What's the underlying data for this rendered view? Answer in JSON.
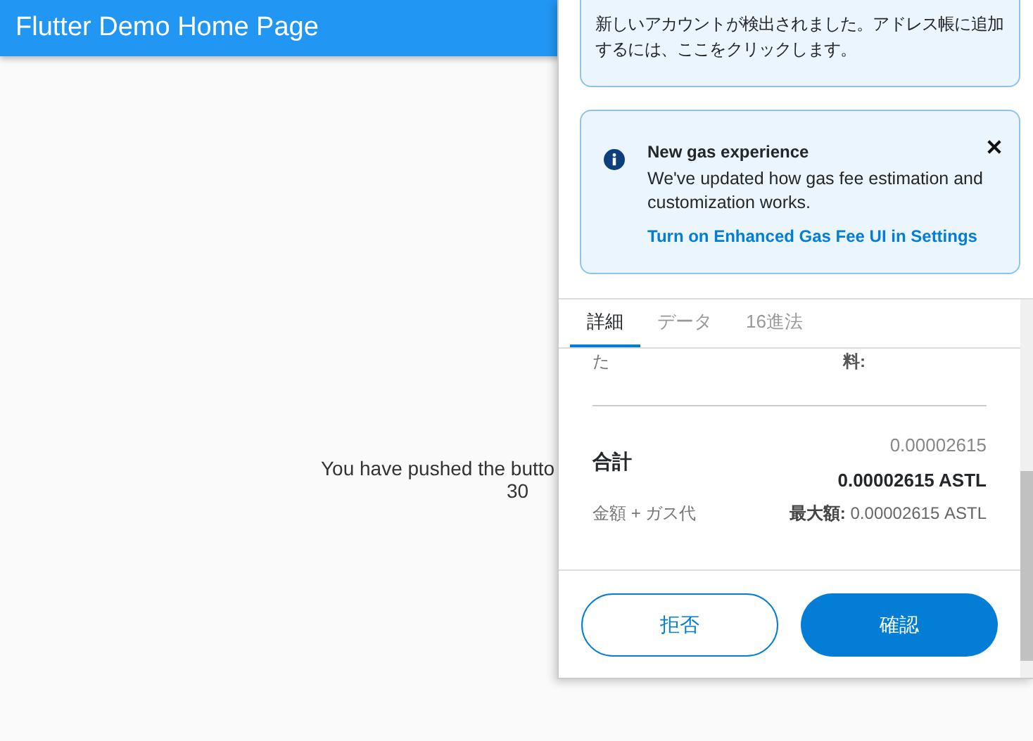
{
  "app_bar": {
    "title": "Flutter Demo Home Page"
  },
  "body": {
    "message": "You have pushed the butto",
    "count": "30"
  },
  "popup": {
    "notices": [
      {
        "kind": "plain",
        "text": "新しいアカウントが検出されました。アドレス帳に追加するには、ここをクリックします。"
      },
      {
        "kind": "info",
        "title": "New gas experience",
        "text": "We've updated how gas fee estimation and customization works.",
        "link": "Turn on Enhanced Gas Fee UI in Settings",
        "dismissible": true
      }
    ],
    "tabs": [
      {
        "label": "詳細",
        "selected": true
      },
      {
        "label": "データ",
        "selected": false
      },
      {
        "label": "16進法",
        "selected": false
      }
    ],
    "details": {
      "row_label": "た",
      "row_value_label": "料:",
      "total_label": "合計",
      "total_amount": "0.00002615",
      "total_amount_bold": "0.00002615 ASTL",
      "total_caption": "金額 + ガス代",
      "max_amount": "**最大額:** 0.00002615 ASTL"
    },
    "buttons": [
      {
        "kind": "secondary",
        "label": "拒否"
      },
      {
        "kind": "primary",
        "label": "確認"
      }
    ]
  }
}
